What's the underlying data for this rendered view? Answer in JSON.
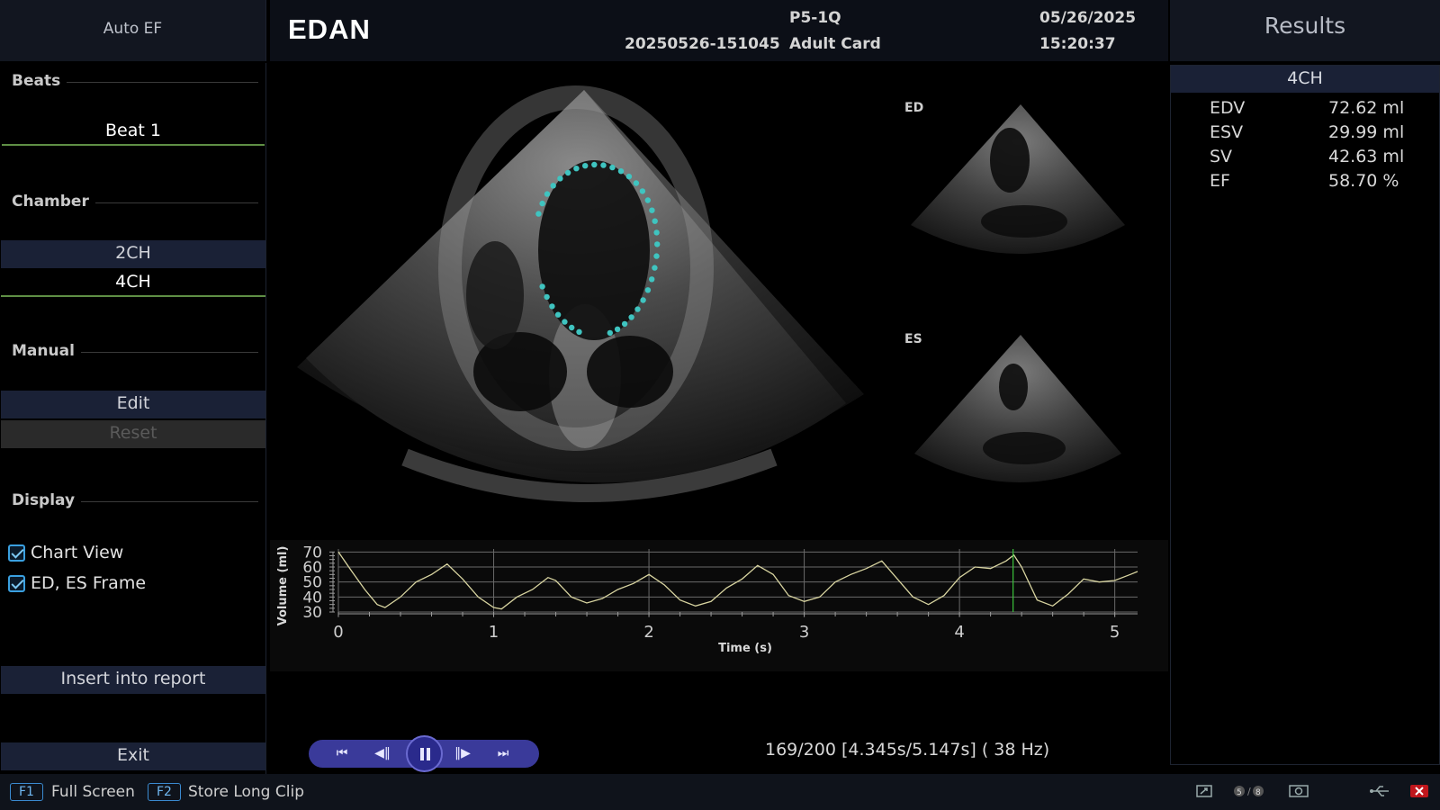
{
  "left_panel": {
    "title": "Auto EF",
    "beats": {
      "heading": "Beats",
      "items": [
        "Beat 1"
      ]
    },
    "chamber": {
      "heading": "Chamber",
      "options": [
        "2CH",
        "4CH"
      ],
      "selected": "4CH"
    },
    "manual": {
      "heading": "Manual",
      "edit_label": "Edit",
      "reset_label": "Reset"
    },
    "display": {
      "heading": "Display",
      "options": [
        {
          "label": "Chart View",
          "checked": true
        },
        {
          "label": "ED, ES Frame",
          "checked": true
        }
      ]
    },
    "insert_label": "Insert into report",
    "exit_label": "Exit"
  },
  "header": {
    "logo": "EDAN",
    "exam_id": "20250526-151045",
    "probe": "P5-1Q",
    "preset": "Adult Card",
    "date": "05/26/2025",
    "time": "15:20:37"
  },
  "viewer": {
    "ed_label": "ED",
    "es_label": "ES",
    "contour_color": "#3fc4c0"
  },
  "chart_data": {
    "type": "line",
    "xlabel": "Time (s)",
    "ylabel": "Volume (ml)",
    "xlim": [
      0,
      5.147
    ],
    "ylim": [
      30,
      72
    ],
    "x_ticks": [
      0,
      1,
      2,
      3,
      4,
      5
    ],
    "y_ticks": [
      30,
      40,
      50,
      60,
      70
    ],
    "grid": true,
    "cursor_x": 4.345,
    "series": [
      {
        "color": "#d8d4a0",
        "x": [
          0,
          0.08,
          0.17,
          0.25,
          0.3,
          0.4,
          0.5,
          0.6,
          0.7,
          0.8,
          0.9,
          1.0,
          1.05,
          1.15,
          1.25,
          1.35,
          1.4,
          1.5,
          1.6,
          1.7,
          1.8,
          1.9,
          2.0,
          2.1,
          2.2,
          2.3,
          2.4,
          2.5,
          2.6,
          2.7,
          2.8,
          2.9,
          3.0,
          3.1,
          3.2,
          3.3,
          3.4,
          3.5,
          3.6,
          3.7,
          3.8,
          3.9,
          4.0,
          4.1,
          4.2,
          4.3,
          4.35,
          4.4,
          4.5,
          4.6,
          4.7,
          4.8,
          4.9,
          5.0,
          5.1,
          5.147
        ],
        "y": [
          70,
          58,
          45,
          35,
          33,
          40,
          50,
          55,
          62,
          52,
          40,
          33,
          32,
          40,
          45,
          53,
          51,
          40,
          36,
          39,
          45,
          49,
          55,
          48,
          38,
          34,
          37,
          46,
          52,
          61,
          55,
          41,
          37,
          40,
          50,
          55,
          59,
          64,
          52,
          40,
          35,
          41,
          53,
          60,
          59,
          64,
          68,
          60,
          38,
          34,
          42,
          52,
          50,
          51,
          55,
          57
        ]
      }
    ]
  },
  "playback": {
    "frame_info": "169/200 [4.345s/5.147s] ( 38 Hz)"
  },
  "results": {
    "title": "Results",
    "view": "4CH",
    "rows": [
      {
        "label": "EDV",
        "value": "72.62 ml"
      },
      {
        "label": "ESV",
        "value": "29.99 ml"
      },
      {
        "label": "SV",
        "value": "42.63 ml"
      },
      {
        "label": "EF",
        "value": "58.70 %"
      }
    ]
  },
  "footer": {
    "f1_key": "F1",
    "f1_label": "Full Screen",
    "f2_key": "F2",
    "f2_label": "Store Long Clip",
    "icons": [
      "export-icon",
      "storage-icon",
      "camera-icon",
      "usb-icon",
      "close-icon"
    ]
  }
}
